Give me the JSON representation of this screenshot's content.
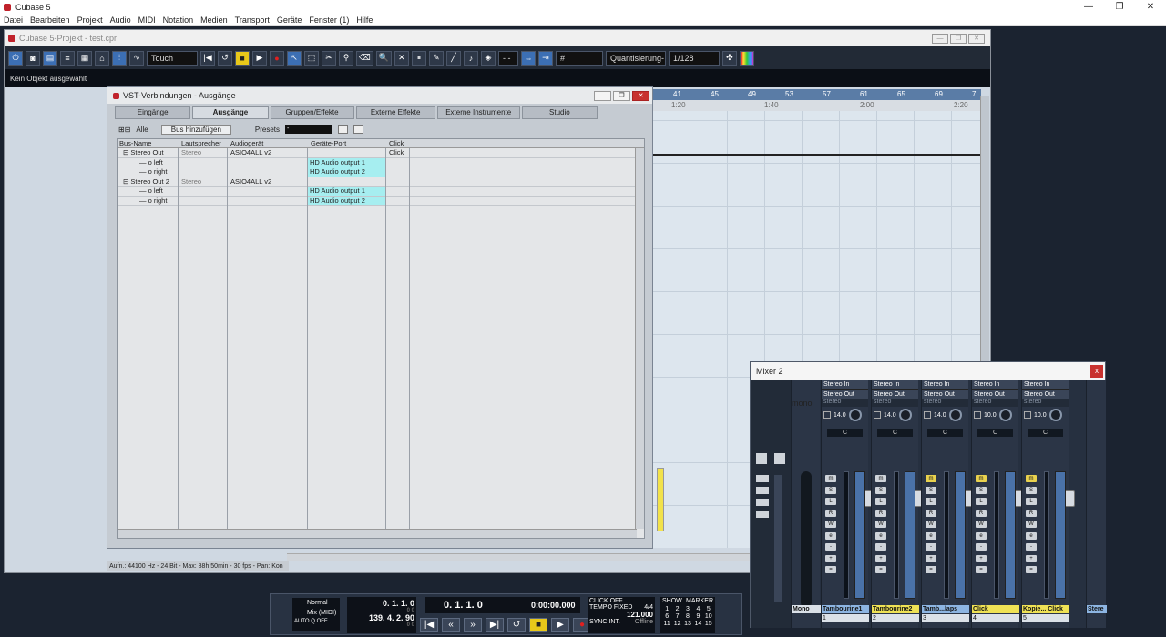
{
  "app": {
    "title": "Cubase 5",
    "win_min": "—",
    "win_max": "❐",
    "win_close": "✕"
  },
  "menu": [
    "Datei",
    "Bearbeiten",
    "Projekt",
    "Audio",
    "MIDI",
    "Notation",
    "Medien",
    "Transport",
    "Geräte",
    "Fenster (1)",
    "Hilfe"
  ],
  "project": {
    "title": "Cubase 5-Projekt - test.cpr",
    "automation_mode": "Touch",
    "quantize_label": "Quantisierung-",
    "quantize_value": "1/128",
    "grid_display": "- -",
    "info_line": "Kein Objekt ausgewählt",
    "status": "Aufn.: 44100 Hz - 24 Bit - Max: 88h 50min - 30 fps - Pan: Kon",
    "ruler_bars": [
      "41",
      "45",
      "49",
      "53",
      "57",
      "61",
      "65",
      "69",
      "7"
    ],
    "ruler_times": [
      "1:20",
      "1:40",
      "2:00",
      "2:20"
    ]
  },
  "vst": {
    "title": "VST-Verbindungen - Ausgänge",
    "tabs": [
      "Eingänge",
      "Ausgänge",
      "Gruppen/Effekte",
      "Externe Effekte",
      "Externe Instrumente",
      "Studio"
    ],
    "active_tab": "Ausgänge",
    "all_label": "Alle",
    "add_bus": "Bus hinzufügen",
    "presets_label": "Presets",
    "presets_value": "-",
    "columns": [
      "Bus-Name",
      "Lautsprecher",
      "Audiogerät",
      "Geräte-Port",
      "Click"
    ],
    "rows": [
      {
        "name": "Stereo Out",
        "speaker": "Stereo",
        "device": "ASIO4ALL v2",
        "port": "",
        "click": "Click",
        "level": 0
      },
      {
        "name": "left",
        "speaker": "",
        "device": "",
        "port": "HD Audio output 1",
        "click": "",
        "level": 1
      },
      {
        "name": "right",
        "speaker": "",
        "device": "",
        "port": "HD Audio output 2",
        "click": "",
        "level": 1
      },
      {
        "name": "Stereo Out 2",
        "speaker": "Stereo",
        "device": "ASIO4ALL v2",
        "port": "",
        "click": "",
        "level": 0
      },
      {
        "name": "left",
        "speaker": "",
        "device": "",
        "port": "HD Audio output 1",
        "click": "",
        "level": 1
      },
      {
        "name": "right",
        "speaker": "",
        "device": "",
        "port": "HD Audio output 2",
        "click": "",
        "level": 1
      }
    ]
  },
  "mixer": {
    "title": "Mixer 2",
    "close": "x",
    "mono_strip": {
      "cfg": "mono",
      "name": "Mono"
    },
    "strips": [
      {
        "in": "Stereo In",
        "out": "Stereo Out",
        "cfg": "stereo",
        "pan": "14.0",
        "cc": "C",
        "vol": "0.00",
        "name": "Tambourine1",
        "num": "1",
        "name_color": "blue",
        "monitor_on": false
      },
      {
        "in": "Stereo In",
        "out": "Stereo Out",
        "cfg": "stereo",
        "pan": "14.0",
        "cc": "C",
        "vol": "0.00",
        "name": "Tambourine2",
        "num": "2",
        "name_color": "yellow",
        "monitor_on": false
      },
      {
        "in": "Stereo In",
        "out": "Stereo Out",
        "cfg": "stereo",
        "pan": "14.0",
        "cc": "C",
        "vol": "0.00",
        "name": "Tamb...laps",
        "num": "3",
        "name_color": "blue",
        "monitor_on": true
      },
      {
        "in": "Stereo In",
        "out": "Stereo Out",
        "cfg": "stereo",
        "pan": "10.0",
        "cc": "C",
        "vol": "0.00",
        "name": "Click",
        "num": "4",
        "name_color": "yellow",
        "monitor_on": true
      },
      {
        "in": "Stereo In",
        "out": "Stereo Out",
        "cfg": "stereo",
        "pan": "10.0",
        "cc": "C",
        "vol": "0.00",
        "name": "Kopie... Click",
        "num": "5",
        "name_color": "yellow",
        "monitor_on": true
      }
    ],
    "right_strip": {
      "name": "Stere"
    }
  },
  "transport": {
    "mode1": "Normal",
    "mode2": "Mix (MIDI)",
    "auto_q": "AUTO Q",
    "auto_q_state": "OFF",
    "left_locator": "0. 1. 1.   0",
    "right_locator": "139. 4. 2. 90",
    "left_sub": "0   0",
    "right_sub": "0   0",
    "position": "0. 1. 1.   0",
    "time": "0:00:00.000",
    "click_label": "CLICK",
    "click_state": "OFF",
    "tempo_label": "TEMPO",
    "tempo_mode": "FIXED",
    "signature": "4/4",
    "tempo": "121.000",
    "sync_label": "SYNC",
    "sync_mode": "INT.",
    "sync_state": "Offline",
    "show_label": "SHOW",
    "marker_label": "MARKER",
    "markers": [
      "1",
      "2",
      "3",
      "4",
      "5",
      "6",
      "7",
      "8",
      "9",
      "10",
      "11",
      "12",
      "13",
      "14",
      "15"
    ]
  }
}
